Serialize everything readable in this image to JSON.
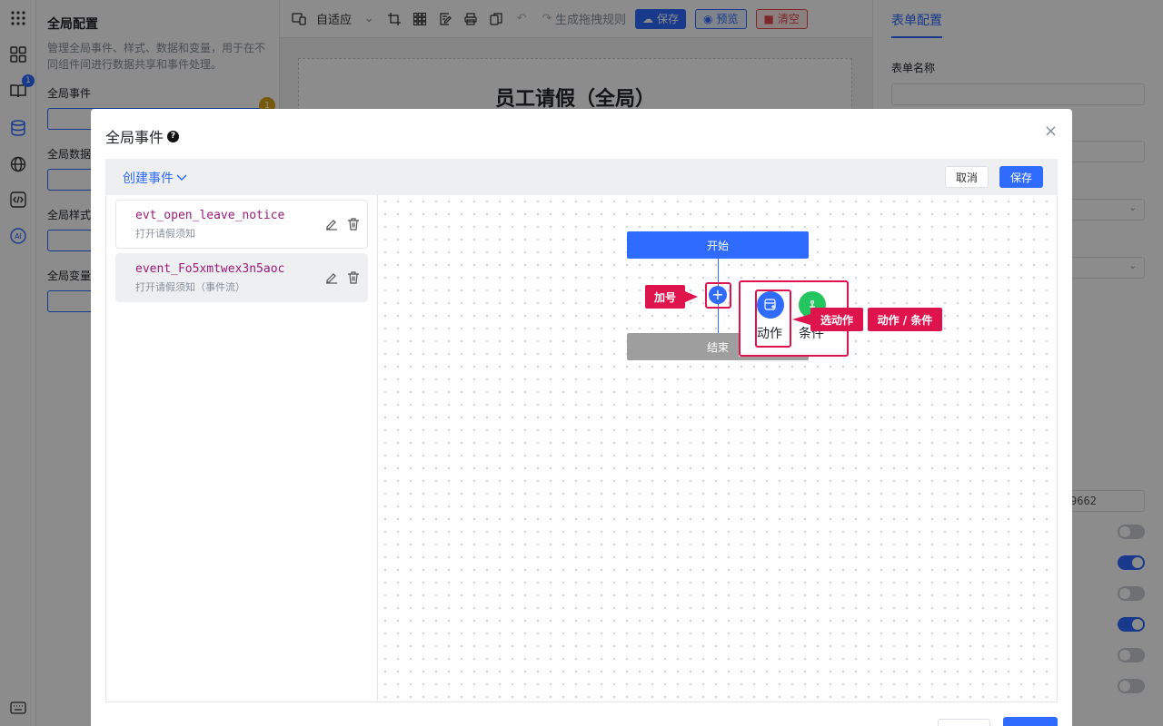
{
  "app": {
    "toolbar": {
      "zoom_label": "自适应",
      "generate_rules": "生成拖拽规则",
      "save": "保存",
      "preview": "预览",
      "clear": "清空"
    },
    "config_panel": {
      "title": "全局配置",
      "description": "管理全局事件、样式、数据和变量，用于在不同组件间进行数据共享和事件处理。",
      "events_label": "全局事件",
      "events_badge": "1",
      "data_label": "全局数据",
      "style_label": "全局样式",
      "vars_label": "全局变量"
    },
    "rail": {
      "book_badge": "1",
      "ai_label": "AI"
    },
    "canvas": {
      "form_title": "员工请假（全局）"
    },
    "right_panel": {
      "tab": "表单配置",
      "form_name_label": "表单名称",
      "partial_value": "9662",
      "toggles": [
        false,
        true,
        false,
        true,
        false,
        false
      ]
    }
  },
  "modal": {
    "title": "全局事件",
    "help": "?",
    "close": "×",
    "create_event": "创建事件",
    "cancel": "取消",
    "save": "保存",
    "events": [
      {
        "name": "evt_open_leave_notice",
        "desc": "打开请假须知",
        "active": false
      },
      {
        "name": "event_Fo5xmtwex3n5aoc",
        "desc": "打开请假须知（事件流）",
        "active": true
      }
    ],
    "flow": {
      "start": "开始",
      "end": "结束",
      "plus": "+",
      "picker_action": "动作",
      "picker_condition": "条件"
    },
    "callouts": {
      "plus": "加号",
      "select_action": "选动作",
      "action_condition": "动作 / 条件"
    }
  }
}
